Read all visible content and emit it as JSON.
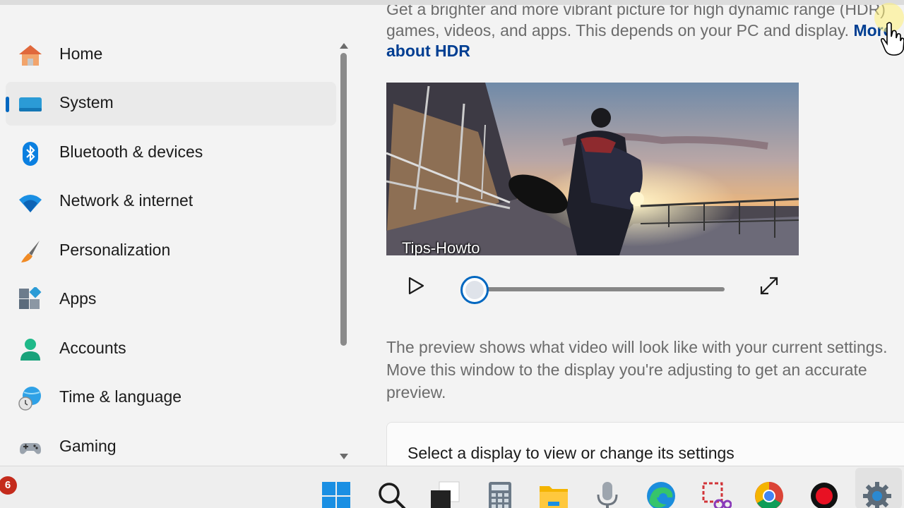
{
  "sidebar": {
    "items": [
      {
        "label": "Home",
        "icon": "home-icon"
      },
      {
        "label": "System",
        "icon": "system-icon",
        "selected": true
      },
      {
        "label": "Bluetooth & devices",
        "icon": "bluetooth-icon"
      },
      {
        "label": "Network & internet",
        "icon": "wifi-icon"
      },
      {
        "label": "Personalization",
        "icon": "brush-icon"
      },
      {
        "label": "Apps",
        "icon": "apps-icon"
      },
      {
        "label": "Accounts",
        "icon": "account-icon"
      },
      {
        "label": "Time & language",
        "icon": "globe-clock-icon"
      },
      {
        "label": "Gaming",
        "icon": "gamepad-icon"
      }
    ]
  },
  "main": {
    "description_line1": "Get a brighter and more vibrant picture for high dynamic range (HDR)",
    "description_line2": "games, videos, and apps. This depends on your PC and display.",
    "link_more": "More",
    "link_about_hdr": "about HDR",
    "video_caption": "Tips-Howto",
    "video_progress": 0,
    "preview_line1": "The preview shows what video will look like with your current settings.",
    "preview_line2": "Move this window to the display you're adjusting to get an accurate",
    "preview_line3": "preview.",
    "display_card_label": "Select a display to view or change its settings"
  },
  "taskbar": {
    "badge_count": "6",
    "icons": [
      "windows-start-icon",
      "search-icon",
      "task-view-icon",
      "calculator-icon",
      "file-explorer-icon",
      "microphone-icon",
      "edge-icon",
      "snipping-tool-icon",
      "chrome-icon",
      "record-icon",
      "settings-gear-icon"
    ]
  },
  "colors": {
    "accent": "#0067c0",
    "link": "#003e92",
    "background": "#f3f3f3"
  }
}
